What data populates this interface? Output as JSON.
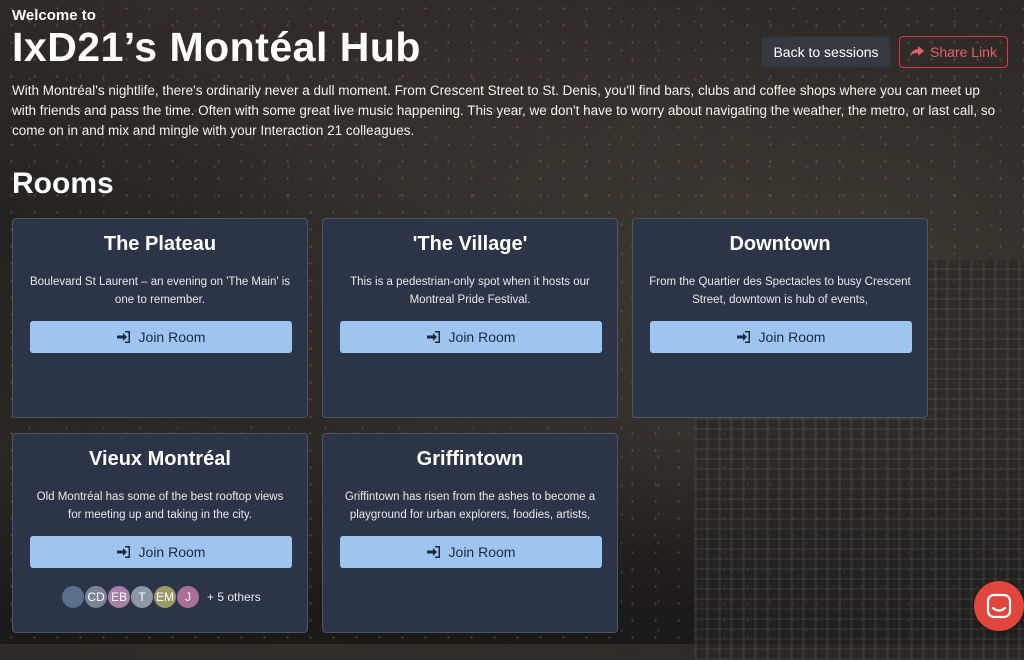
{
  "header": {
    "welcome": "Welcome to",
    "title": "IxD21’s Montéal Hub",
    "back_label": "Back to sessions",
    "share_label": "Share Link"
  },
  "intro": "With Montréal's nightlife, there's ordinarily never a dull moment. From Crescent Street to St. Denis, you'll find bars, clubs and coffee shops where you can meet up with friends and pass the time. Often with some great live music happening. This year, we don't have to worry about navigating the weather, the metro, or last call, so come on in and mix and mingle with your Interaction 21 colleagues.",
  "rooms_heading": "Rooms",
  "join_label": "Join Room",
  "rooms": [
    {
      "title": "The Plateau",
      "description": "Boulevard St Laurent – an evening on 'The Main' is one to remember."
    },
    {
      "title": "'The Village'",
      "description": "This is a pedestrian-only spot when it hosts our Montreal Pride Festival."
    },
    {
      "title": "Downtown",
      "description": "From the Quartier des Spectacles to busy Crescent Street, downtown is hub of events,"
    },
    {
      "title": "Vieux Montréal",
      "description": "Old Montréal has some of the best rooftop views for meeting up and taking in the city."
    },
    {
      "title": "Griffintown",
      "description": "Griffintown has risen from the ashes to become a playground for urban explorers, foodies, artists,"
    }
  ],
  "participants": {
    "avatars": [
      {
        "initials": "",
        "color": "#5a6f8a"
      },
      {
        "initials": "CD",
        "color": "#7b8494"
      },
      {
        "initials": "EB",
        "color": "#a77fa8"
      },
      {
        "initials": "T",
        "color": "#8c98a3"
      },
      {
        "initials": "EM",
        "color": "#9a9a6a"
      },
      {
        "initials": "J",
        "color": "#a86f9a"
      }
    ],
    "others": "+ 5 others"
  },
  "colors": {
    "card_bg": "#2c3547",
    "join_button": "#9ec5f0",
    "share_accent": "#dc3545",
    "chat_widget": "#e0463e"
  }
}
